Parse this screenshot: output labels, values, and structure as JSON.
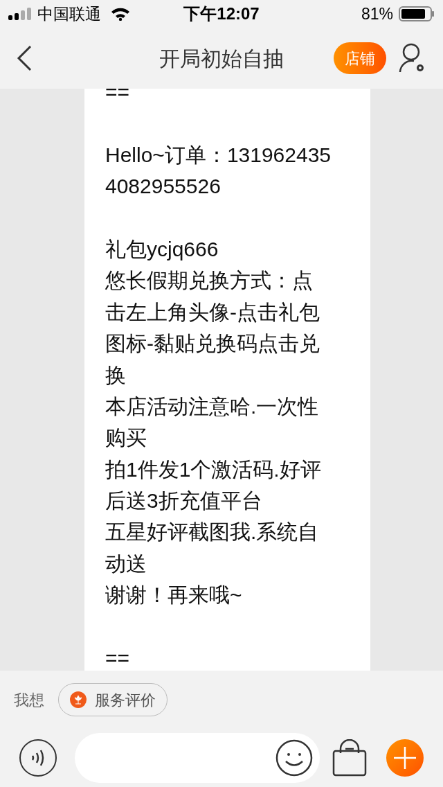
{
  "status_bar": {
    "carrier": "中国联通",
    "time": "下午12:07",
    "battery": "81%"
  },
  "header": {
    "title": "开局初始自抽",
    "shop_button": "店铺"
  },
  "message": {
    "paragraphs": [
      [
        "=="
      ],
      [
        "Hello~订单：131962435",
        "4082955526"
      ],
      [
        "礼包ycjq666",
        "悠长假期兑换方式：点",
        "击左上角头像-点击礼包",
        "图标-黏贴兑换码点击兑",
        "换",
        "本店活动注意哈.一次性",
        "购买",
        "拍1件发1个激活码.好评",
        "后送3折充值平台",
        "五星好评截图我.系统自",
        "动送",
        "谢谢！再来哦~"
      ],
      [
        "=="
      ]
    ]
  },
  "quick_actions": {
    "label": "我想",
    "chips": [
      "服务评价"
    ]
  }
}
